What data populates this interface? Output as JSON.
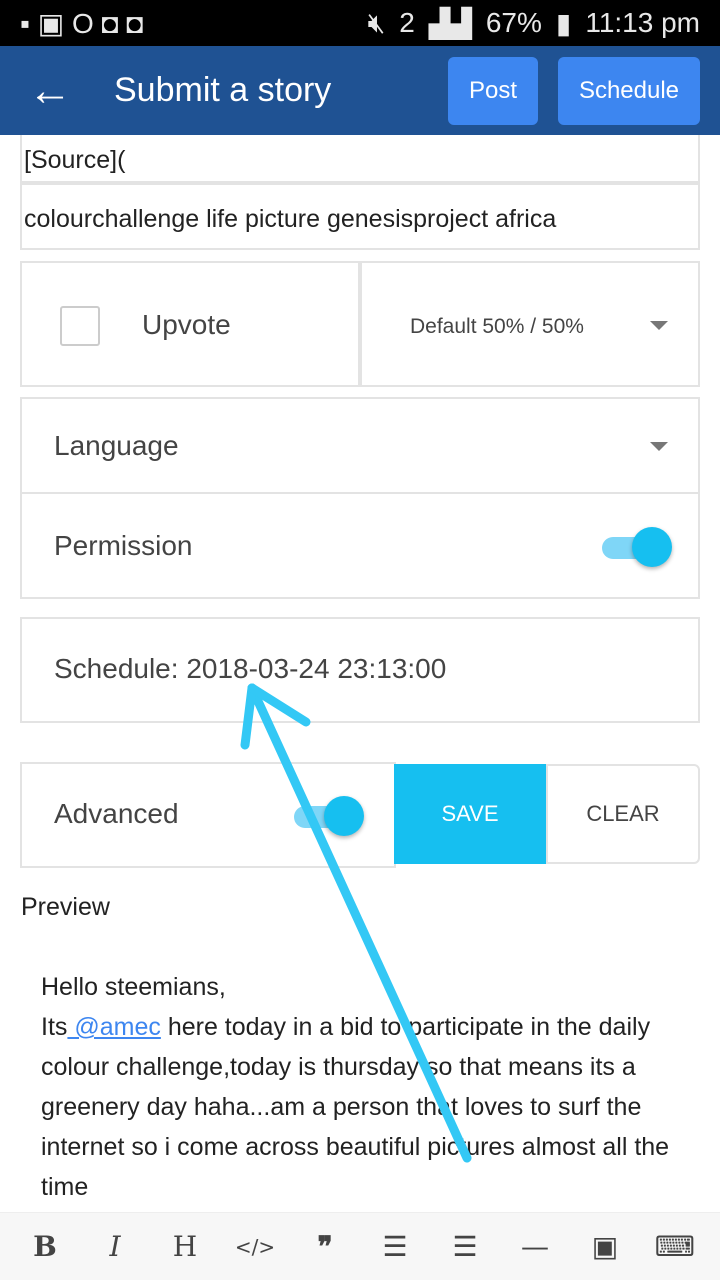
{
  "status_bar": {
    "battery": "67%",
    "time": "11:13 pm",
    "sim": "2"
  },
  "header": {
    "title": "Submit a story",
    "post_label": "Post",
    "schedule_label": "Schedule",
    "back_icon": "arrow-left-icon"
  },
  "body_textarea": {
    "last_line": "[Source]("
  },
  "tags_input": {
    "value": "colourchallenge life picture genesisproject africa"
  },
  "upvote": {
    "label": "Upvote",
    "checked": false,
    "reward_select": "Default 50% / 50%"
  },
  "language": {
    "label": "Language"
  },
  "permission": {
    "label": "Permission",
    "enabled": true
  },
  "schedule": {
    "label": "Schedule: 2018-03-24 23:13:00"
  },
  "advanced": {
    "label": "Advanced",
    "enabled": true,
    "save_label": "SAVE",
    "clear_label": "CLEAR"
  },
  "preview": {
    "heading": "Preview",
    "line1": "Hello steemians,",
    "mention_prefix": "Its",
    "mention": " @amec",
    "rest": " here today in a bid to participate in the daily colour challenge,today is thursday so that means its a greenery day haha...am a person that loves to surf the internet so i come across beautiful pictures almost all the time"
  },
  "toolbar": {
    "bold": "B",
    "italic": "I",
    "heading": "H",
    "code": "</>",
    "quote": "❞",
    "ol": "☰",
    "ul": "☰",
    "hr": "—",
    "image": "▣",
    "keyboard": "⌨"
  },
  "colors": {
    "appbar": "#1f5293",
    "button": "#3d86f0",
    "accent": "#16bff0",
    "annotation_arrow": "#33c8f5"
  }
}
